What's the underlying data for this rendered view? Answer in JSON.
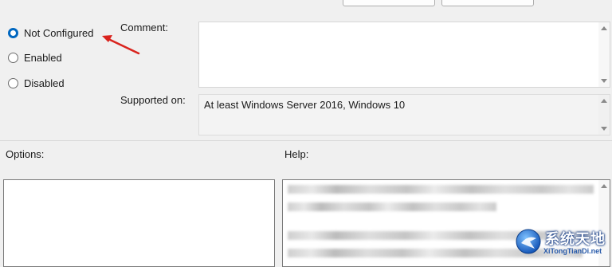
{
  "state": {
    "options": [
      {
        "label": "Not Configured",
        "selected": true
      },
      {
        "label": "Enabled",
        "selected": false
      },
      {
        "label": "Disabled",
        "selected": false
      }
    ]
  },
  "fields": {
    "comment_label": "Comment:",
    "supported_label": "Supported on:",
    "supported_value": "At least Windows Server 2016, Windows 10"
  },
  "sections": {
    "options_label": "Options:",
    "help_label": "Help:"
  },
  "watermark": {
    "title": "系统天地",
    "subtitle": "XiTongTianDi.net"
  },
  "colors": {
    "radio_selected": "#0067c0",
    "annotation_arrow": "#d9231d"
  }
}
